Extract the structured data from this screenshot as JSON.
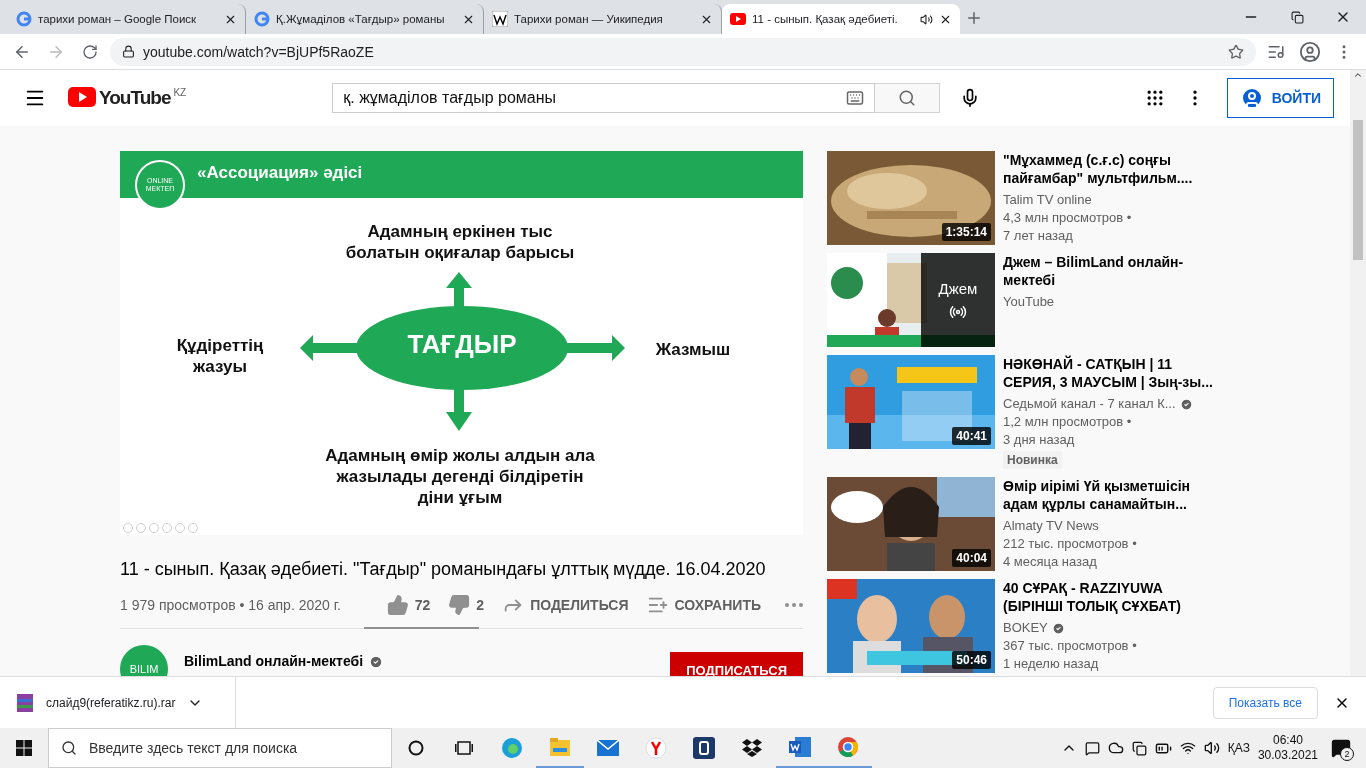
{
  "browser": {
    "tabs": [
      {
        "title": "тарихи роман – Google Поиск",
        "kind": "google",
        "selected": false
      },
      {
        "title": "Қ.Жұмаділов «Тағдыр» романы",
        "kind": "google",
        "selected": false
      },
      {
        "title": "Тарихи роман — Уикипедия",
        "kind": "wiki",
        "selected": false
      },
      {
        "title": "11 - сынып. Қазақ әдебиеті.",
        "kind": "youtube",
        "selected": true,
        "audio": true
      }
    ],
    "url": "youtube.com/watch?v=BjUPf5RaoZE"
  },
  "header": {
    "logo": "YouTube",
    "country": "KZ",
    "search_value": "қ. жұмаділов тағдыр романы",
    "sign_in": "ВОЙТИ"
  },
  "slide": {
    "title": "«Ассоциация» әдісі",
    "logo": [
      "ONLINE",
      "МЕКТЕП"
    ],
    "top": "Адамның еркінен тыс болатын оқиғалар барысы",
    "left": "Құдіреттің жазуы",
    "right": "Жазмыш",
    "center": "ТАҒДЫР",
    "bottom": "Адамның өмір жолы алдын ала жазылады дегенді білдіретін діни ұғым"
  },
  "video": {
    "title": "11 - сынып. Қазақ әдебиеті. \"Тағдыр\" романындағы ұлттық мүдде. 16.04.2020",
    "meta": "1 979 просмотров • 16 апр. 2020 г.",
    "likes": "72",
    "dislikes": "2",
    "share": "ПОДЕЛИТЬСЯ",
    "save": "СОХРАНИТЬ"
  },
  "channel": {
    "avatar": "BILIM",
    "name": "BilimLand онлайн-мектебі",
    "verified": true,
    "subscribe": "ПОДПИСАТЬСЯ"
  },
  "related": [
    {
      "title": "\"Мұхаммед (с.ғ.с) соңғы пайғамбар\" мультфильм....",
      "channel": "Talim TV online",
      "verified": false,
      "views": "4,3 млн просмотров •",
      "age": "7 лет назад",
      "duration": "1:35:14"
    },
    {
      "title": "Джем – BilimLand онлайн-мектебі",
      "channel": "YouTube",
      "verified": false,
      "overlay": "Джем"
    },
    {
      "title": "НӘКӨНАЙ - САТҚЫН | 11 СЕРИЯ, 3 МАУСЫМ | Зың-зы...",
      "channel": "Седьмой канал - 7 канал К...",
      "verified": true,
      "views": "1,2 млн просмотров •",
      "age": "3 дня назад",
      "duration": "40:41",
      "badge": "Новинка"
    },
    {
      "title": "Өмір иірімі Үй қызметшісін адам құрлы санамайтын...",
      "channel": "Almaty TV News",
      "verified": false,
      "views": "212 тыс. просмотров •",
      "age": "4 месяца назад",
      "duration": "40:04"
    },
    {
      "title": "40 СҰРАҚ - RAZZIYUWA (БІРІНШІ ТОЛЫҚ СҰХБАТ)",
      "channel": "BOKEY",
      "verified": true,
      "views": "367 тыс. просмотров •",
      "age": "1 неделю назад",
      "duration": "50:46"
    }
  ],
  "downloads": {
    "file": "слайд9(referatikz.ru).rar",
    "show_all": "Показать все"
  },
  "taskbar": {
    "search_placeholder": "Введите здесь текст для поиска",
    "lang": "ҚАЗ",
    "time": "06:40",
    "date": "30.03.2021",
    "notifications": "2"
  }
}
